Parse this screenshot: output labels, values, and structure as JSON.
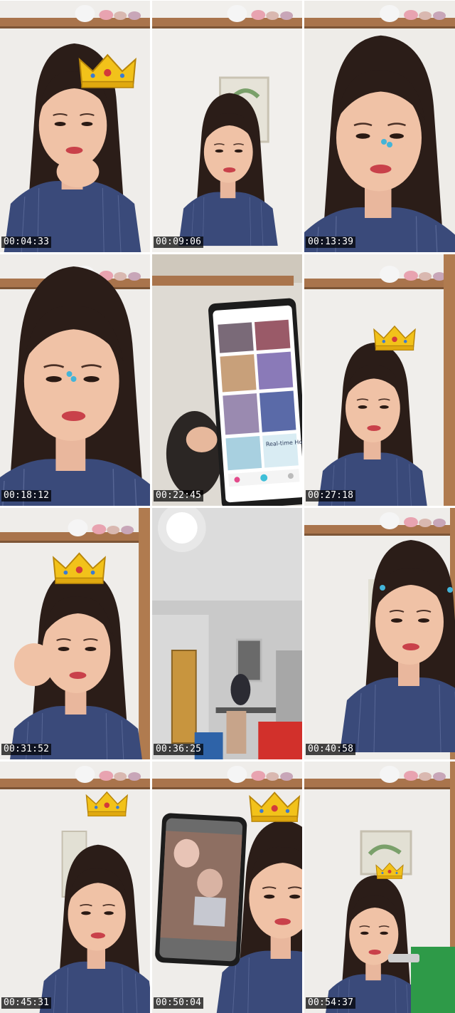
{
  "contact_sheet": {
    "frames": [
      {
        "timestamp": "00:04:33",
        "scene": "selfie-crown-hand-on-cheek"
      },
      {
        "timestamp": "00:09:06",
        "scene": "selfie-eyes-closed"
      },
      {
        "timestamp": "00:13:39",
        "scene": "selfie-closeup"
      },
      {
        "timestamp": "00:18:12",
        "scene": "selfie-closeup-smile"
      },
      {
        "timestamp": "00:22:45",
        "scene": "phone-screen-app"
      },
      {
        "timestamp": "00:27:18",
        "scene": "selfie-crown-eyes-closed"
      },
      {
        "timestamp": "00:31:52",
        "scene": "selfie-crown-leaning"
      },
      {
        "timestamp": "00:36:25",
        "scene": "room-ceiling-light"
      },
      {
        "timestamp": "00:40:58",
        "scene": "selfie-pout"
      },
      {
        "timestamp": "00:45:31",
        "scene": "selfie-crown-smile"
      },
      {
        "timestamp": "00:50:04",
        "scene": "phone-screen-photo-crown"
      },
      {
        "timestamp": "00:54:37",
        "scene": "selfie-crown-looking-down"
      }
    ],
    "phone_app_text": {
      "panel_label": "Real-time Host List"
    }
  }
}
